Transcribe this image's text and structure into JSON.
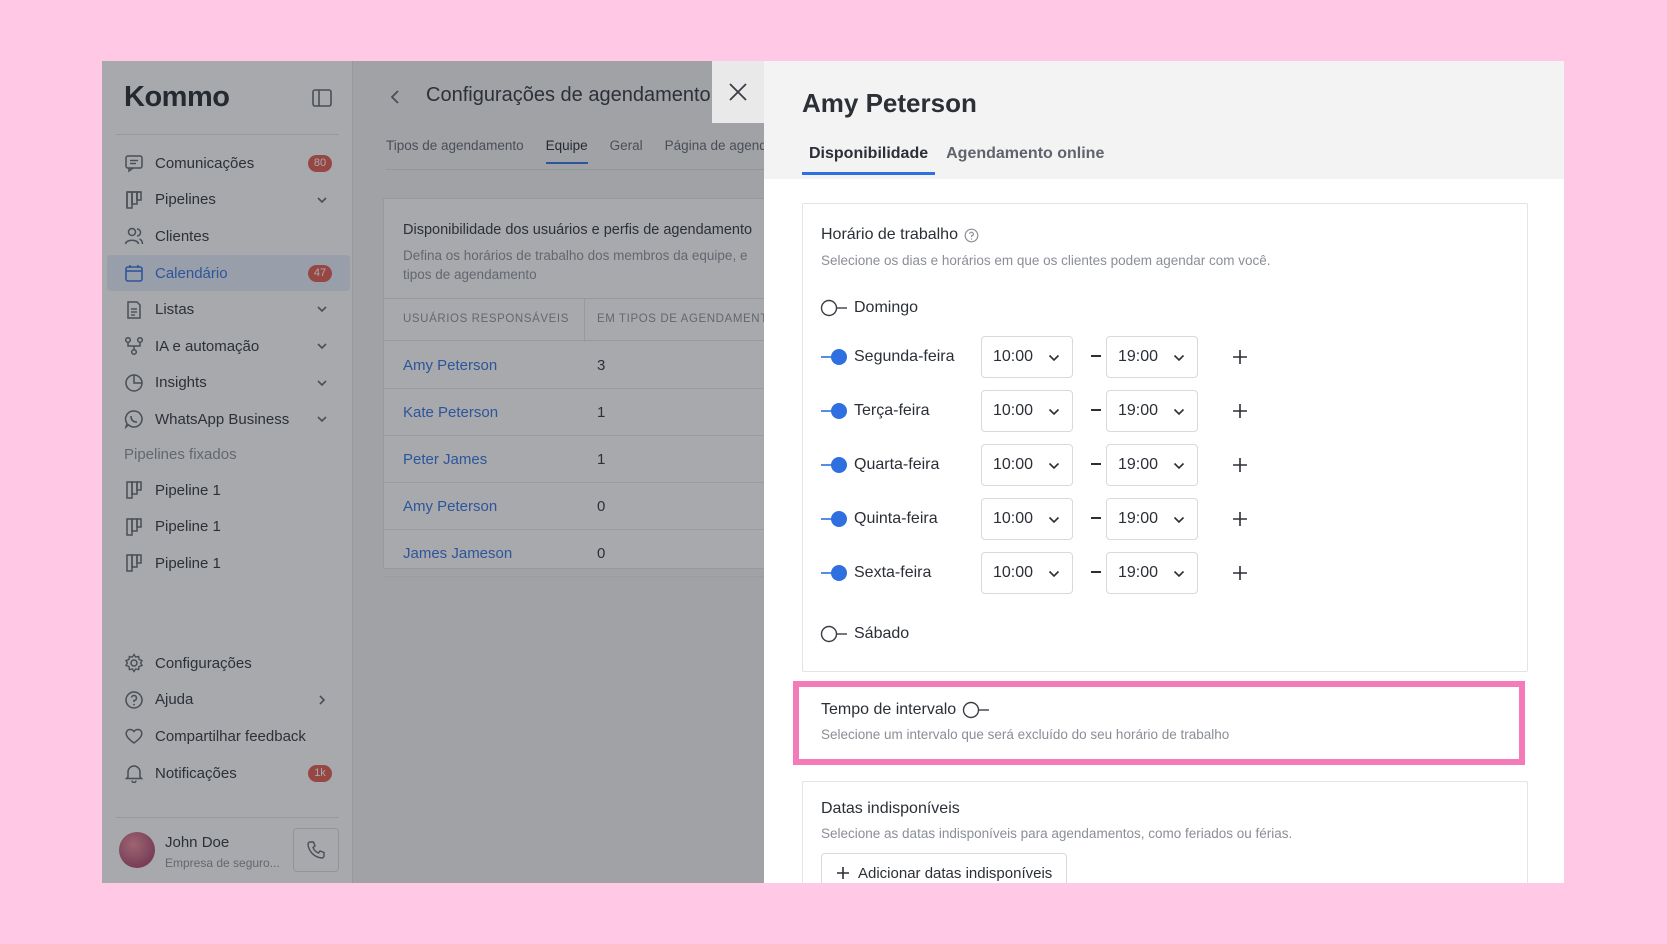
{
  "sidebar": {
    "logo": "Kommo",
    "items": [
      {
        "label": "Comunicações",
        "badge": "80"
      },
      {
        "label": "Pipelines"
      },
      {
        "label": "Clientes"
      },
      {
        "label": "Calendário",
        "badge": "47"
      },
      {
        "label": "Listas"
      },
      {
        "label": "IA e automação"
      },
      {
        "label": "Insights"
      },
      {
        "label": "WhatsApp Business"
      }
    ],
    "pinned_heading": "Pipelines fixados",
    "pinned": [
      "Pipeline 1",
      "Pipeline 1",
      "Pipeline 1"
    ],
    "bottom": [
      {
        "label": "Configurações"
      },
      {
        "label": "Ajuda"
      },
      {
        "label": "Compartilhar feedback"
      },
      {
        "label": "Notificações",
        "badge": "1k"
      }
    ],
    "user": {
      "name": "John Doe",
      "company": "Empresa de seguro..."
    }
  },
  "settings": {
    "title": "Configurações de agendamento",
    "tabs": [
      "Tipos de agendamento",
      "Equipe",
      "Geral",
      "Página de agenda"
    ],
    "card": {
      "title": "Disponibilidade dos usuários e perfis de agendamento",
      "description": "Defina os horários de trabalho dos membros da equipe, e tipos de agendamento",
      "columns": [
        "USUÁRIOS RESPONSÁVEIS",
        "EM TIPOS DE AGENDAMENTO"
      ],
      "rows": [
        {
          "name": "Amy Peterson",
          "count": "3"
        },
        {
          "name": "Kate Peterson",
          "count": "1"
        },
        {
          "name": "Peter James",
          "count": "1"
        },
        {
          "name": "Amy Peterson",
          "count": "0"
        },
        {
          "name": "James Jameson",
          "count": "0"
        }
      ]
    }
  },
  "panel": {
    "title": "Amy Peterson",
    "tabs": [
      "Disponibilidade",
      "Agendamento online"
    ],
    "working_hours": {
      "title": "Horário de trabalho",
      "description": "Selecione os dias e horários em que os clientes podem agendar com você.",
      "days": [
        {
          "label": "Domingo",
          "enabled": false
        },
        {
          "label": "Segunda-feira",
          "enabled": true,
          "from": "10:00",
          "to": "19:00"
        },
        {
          "label": "Terça-feira",
          "enabled": true,
          "from": "10:00",
          "to": "19:00"
        },
        {
          "label": "Quarta-feira",
          "enabled": true,
          "from": "10:00",
          "to": "19:00"
        },
        {
          "label": "Quinta-feira",
          "enabled": true,
          "from": "10:00",
          "to": "19:00"
        },
        {
          "label": "Sexta-feira",
          "enabled": true,
          "from": "10:00",
          "to": "19:00"
        },
        {
          "label": "Sábado",
          "enabled": false
        }
      ]
    },
    "break_time": {
      "title": "Tempo de intervalo",
      "description": "Selecione um intervalo que será excluído do seu horário de trabalho",
      "enabled": false
    },
    "unavailable": {
      "title": "Datas indisponíveis",
      "description": "Selecione as datas indisponíveis para agendamentos, como feriados ou férias.",
      "button": "Adicionar datas indisponíveis"
    }
  },
  "colors": {
    "accent": "#2f6fe0",
    "highlight": "#f57ab8",
    "badge": "#e2574c",
    "background": "#ffc8e4"
  }
}
